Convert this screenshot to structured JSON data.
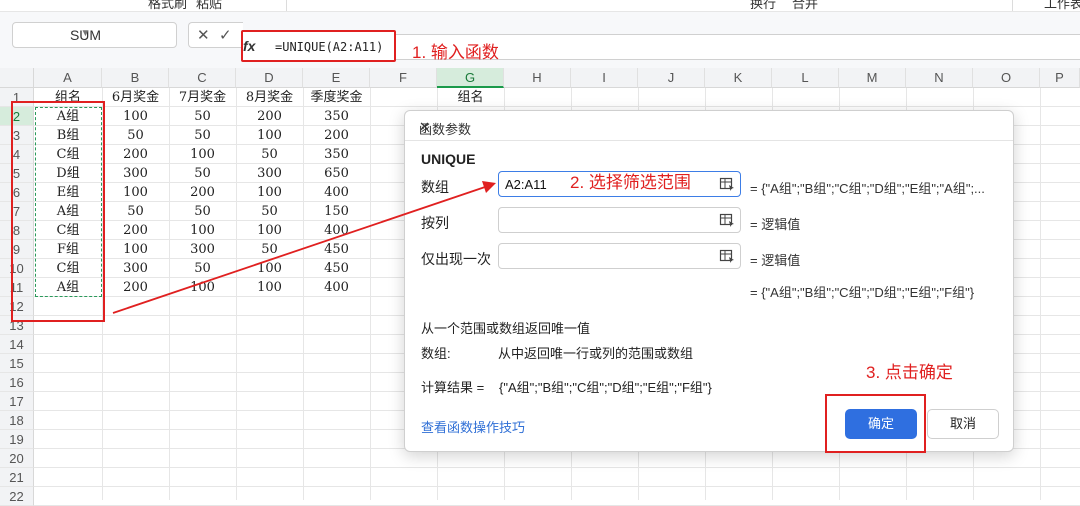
{
  "toolbar": {
    "items": [
      "格式刷",
      "粘贴",
      "换行",
      "合并",
      "工作表"
    ]
  },
  "formula_bar": {
    "name_box": "SUM",
    "fx_label": "fx",
    "formula": "=UNIQUE(A2:A11)"
  },
  "annotations": {
    "step1": "1. 输入函数",
    "step2": "2. 选择筛选范围",
    "step3": "3. 点击确定"
  },
  "columns": [
    "A",
    "B",
    "C",
    "D",
    "E",
    "F",
    "G",
    "H",
    "I",
    "J",
    "K",
    "L",
    "M",
    "N",
    "O",
    "P"
  ],
  "rows": [
    "1",
    "2",
    "3",
    "4",
    "5",
    "6",
    "7",
    "8",
    "9",
    "10",
    "11",
    "12",
    "13",
    "14",
    "15",
    "16",
    "17",
    "18",
    "19",
    "20",
    "21",
    "22"
  ],
  "sheet": {
    "headers": [
      "组名",
      "6月奖金",
      "7月奖金",
      "8月奖金",
      "季度奖金"
    ],
    "data": [
      [
        "A组",
        "100",
        "50",
        "200",
        "350"
      ],
      [
        "B组",
        "50",
        "50",
        "100",
        "200"
      ],
      [
        "C组",
        "200",
        "100",
        "50",
        "350"
      ],
      [
        "D组",
        "300",
        "50",
        "300",
        "650"
      ],
      [
        "E组",
        "100",
        "200",
        "100",
        "400"
      ],
      [
        "A组",
        "50",
        "50",
        "50",
        "150"
      ],
      [
        "C组",
        "200",
        "100",
        "100",
        "400"
      ],
      [
        "F组",
        "100",
        "300",
        "50",
        "450"
      ],
      [
        "C组",
        "300",
        "50",
        "100",
        "450"
      ],
      [
        "A组",
        "200",
        "100",
        "100",
        "400"
      ]
    ],
    "g1": "组名"
  },
  "dialog": {
    "title": "函数参数",
    "function_name": "UNIQUE",
    "args": [
      {
        "label": "数组",
        "value": "A2:A11",
        "result": "= {\"A组\";\"B组\";\"C组\";\"D组\";\"E组\";\"A组\";..."
      },
      {
        "label": "按列",
        "value": "",
        "result": "= 逻辑值"
      },
      {
        "label": "仅出现一次",
        "value": "",
        "result": "= 逻辑值"
      }
    ],
    "overall_result": "= {\"A组\";\"B组\";\"C组\";\"D组\";\"E组\";\"F组\"}",
    "description": "从一个范围或数组返回唯一值",
    "param_name": "数组:",
    "param_desc": "从中返回唯一行或列的范围或数组",
    "calc_label": "计算结果 =",
    "calc_value": "{\"A组\";\"B组\";\"C组\";\"D组\";\"E组\";\"F组\"}",
    "help_link": "查看函数操作技巧",
    "ok_label": "确定",
    "cancel_label": "取消"
  }
}
